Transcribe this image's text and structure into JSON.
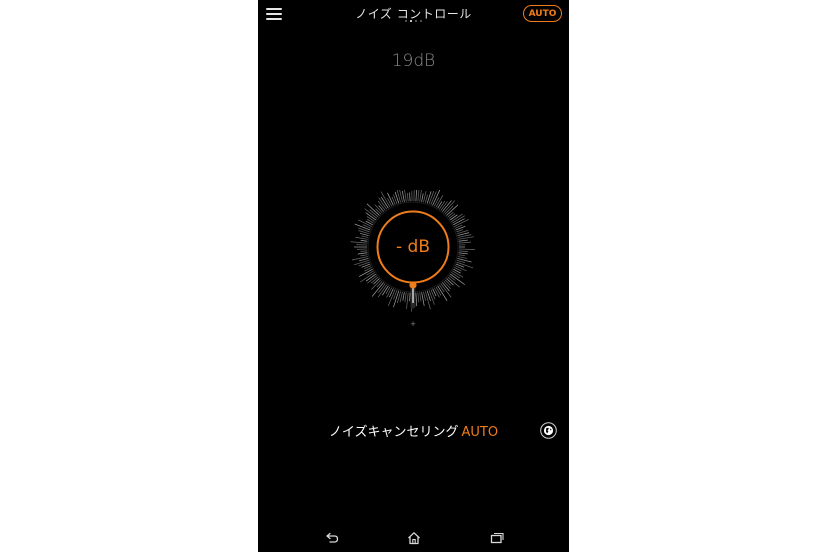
{
  "header": {
    "title": "ノイズ コントロール",
    "page_count": 4,
    "active_page": 1,
    "auto_button": "AUTO",
    "menu_icon": "hamburger-menu-icon"
  },
  "ambient": {
    "level": "19dB"
  },
  "dial": {
    "value": "- dB",
    "plus_label": "+",
    "accent_color": "#ef7d1a"
  },
  "mode": {
    "label": "ノイズキャンセリング",
    "badge": "AUTO",
    "globe_icon": "globe-icon"
  },
  "nav": {
    "back_icon": "back-icon",
    "home_icon": "home-icon",
    "recents_icon": "recent-apps-icon"
  },
  "colors": {
    "accent": "#ef7d1a",
    "background": "#000000",
    "text": "#dcdcdc"
  }
}
